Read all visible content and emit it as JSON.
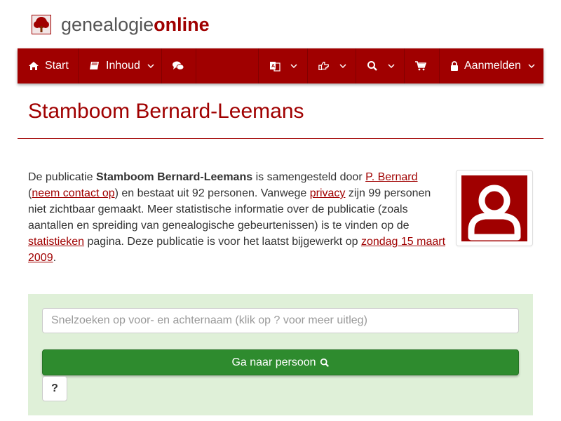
{
  "brand": {
    "part1": "genealogie",
    "part2": "online",
    "logo_icon": "tree-icon"
  },
  "nav": {
    "start": "Start",
    "inhoud": "Inhoud",
    "login": "Aanmelden",
    "icons": [
      "home-icon",
      "book-icon",
      "comments-icon",
      "language-icon",
      "hand-pointer-icon",
      "search-icon",
      "cart-icon",
      "lock-icon"
    ]
  },
  "page": {
    "title": "Stamboom Bernard-Leemans"
  },
  "intro": {
    "t1": "De publicatie ",
    "pub_name": "Stamboom Bernard-Leemans",
    "t2": " is samengesteld door ",
    "author_link": "P. Bernard",
    "t3": " (",
    "contact_link": "neem contact op",
    "t4": ") en bestaat uit 92 personen. Vanwege ",
    "privacy_link": "privacy",
    "t5": " zijn 99 personen niet zichtbaar gemaakt. Meer statistische informatie over de publicatie (zoals aantallen en spreiding van genealogische gebeurtenissen) is te vinden op de ",
    "stats_link": "statistieken",
    "t6": " pagina. Deze publicatie is voor het laatst bijgewerkt op ",
    "date_link": "zondag 15 maart 2009",
    "t7": "."
  },
  "search": {
    "placeholder": "Snelzoeken op voor- en achternaam (klik op ? voor meer uitleg)",
    "button_label": "Ga naar persoon",
    "help_label": "?"
  },
  "colors": {
    "brand_red": "#a00000",
    "panel_green": "#dff0d8",
    "button_green": "#2e8b2e"
  }
}
